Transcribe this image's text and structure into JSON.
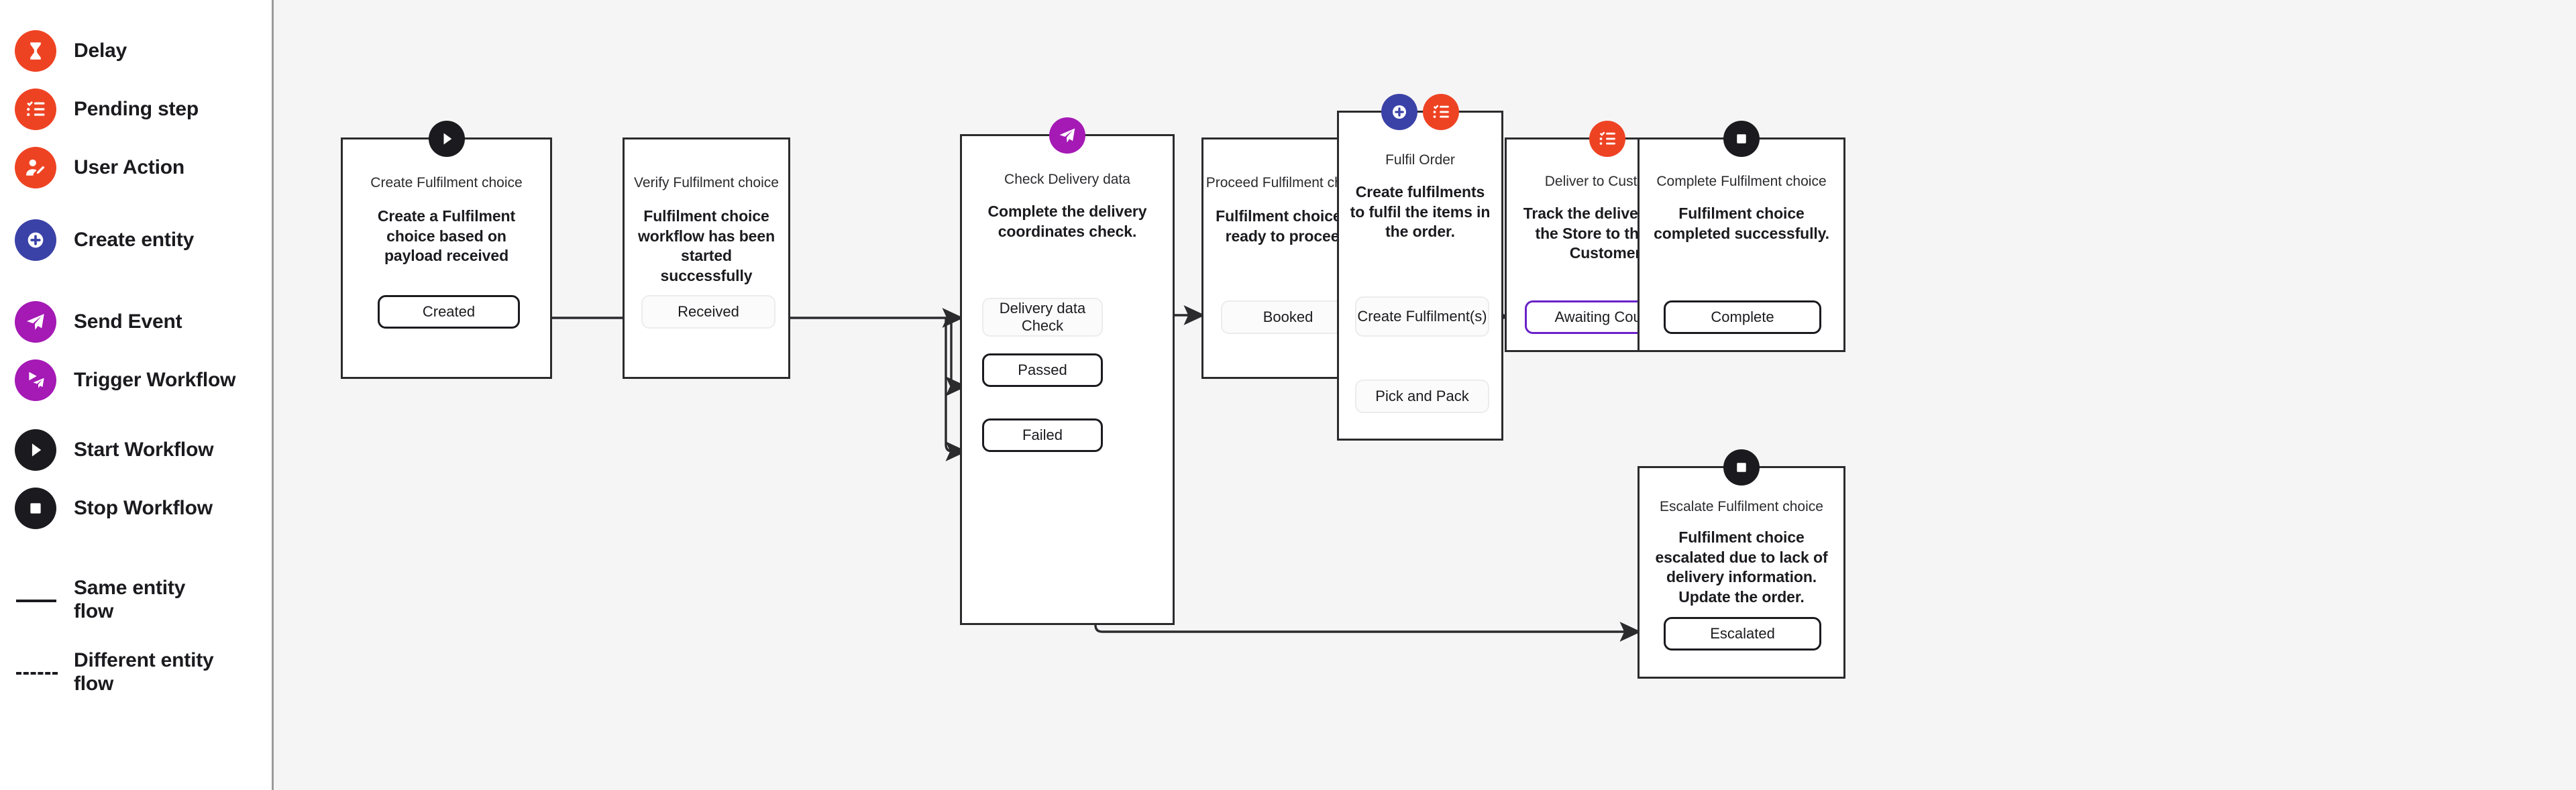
{
  "legend": {
    "items": [
      {
        "label": "Delay",
        "icon": "hourglass-icon",
        "color": "#ee4323",
        "kind": "icon"
      },
      {
        "label": "Pending step",
        "icon": "checklist-icon",
        "color": "#ee4323",
        "kind": "icon"
      },
      {
        "label": "User Action",
        "icon": "user-edit-icon",
        "color": "#ee4323",
        "kind": "icon"
      },
      {
        "label": "Create entity",
        "icon": "plus-circle-icon",
        "color": "#3a42a8",
        "kind": "icon"
      },
      {
        "label": "Send Event",
        "icon": "paper-plane-icon",
        "color": "#a519b5",
        "kind": "icon"
      },
      {
        "label": "Trigger Workflow",
        "icon": "trigger-workflow-icon",
        "color": "#a519b5",
        "kind": "icon"
      },
      {
        "label": "Start Workflow",
        "icon": "play-circle-icon",
        "color": "#1b1b1f",
        "kind": "icon"
      },
      {
        "label": "Stop Workflow",
        "icon": "stop-circle-icon",
        "color": "#1b1b1f",
        "kind": "icon"
      },
      {
        "label": "Same entity\nflow",
        "icon": "solid-line-icon",
        "color": "#1b1b1f",
        "kind": "line-solid"
      },
      {
        "label": "Different entity\nflow",
        "icon": "dashed-line-icon",
        "color": "#1b1b1f",
        "kind": "line-dashed"
      }
    ]
  },
  "diagram": {
    "nodes": [
      {
        "id": "create-fulfilment-choice",
        "title": "Create Fulfilment choice",
        "description": "Create a Fulfilment choice based on payload received",
        "badges": [
          {
            "icon": "play-circle-icon",
            "color": "#1b1b1f"
          }
        ],
        "steps": [
          {
            "label": "Created",
            "style": "strong"
          }
        ]
      },
      {
        "id": "verify-fulfilment-choice",
        "title": "Verify Fulfilment choice",
        "description": "Fulfilment choice workflow has been started successfully",
        "badges": [],
        "steps": [
          {
            "label": "Received",
            "style": "soft"
          }
        ]
      },
      {
        "id": "check-delivery-data",
        "title": "Check Delivery data",
        "description": "Complete the delivery coordinates check.",
        "badges": [
          {
            "icon": "paper-plane-icon",
            "color": "#a519b5"
          }
        ],
        "steps": [
          {
            "label": "Delivery data Check",
            "style": "soft"
          },
          {
            "label": "Passed",
            "style": "strong"
          },
          {
            "label": "Failed",
            "style": "strong"
          }
        ]
      },
      {
        "id": "proceed-fulfilment-choice",
        "title": "Proceed Fulfilment choice",
        "description": "Fulfilment choice is ready to proceed",
        "badges": [],
        "steps": [
          {
            "label": "Booked",
            "style": "soft"
          }
        ]
      },
      {
        "id": "fulfil-order",
        "title": "Fulfil Order",
        "description": "Create fulfilments to fulfil the items in the order.",
        "badges": [
          {
            "icon": "plus-circle-icon",
            "color": "#3a42a8"
          },
          {
            "icon": "checklist-icon",
            "color": "#ee4323"
          }
        ],
        "steps": [
          {
            "label": "Create Fulfilment(s)",
            "style": "soft"
          },
          {
            "label": "Pick and Pack",
            "style": "soft"
          }
        ]
      },
      {
        "id": "deliver-to-customer",
        "title": "Deliver to Customer",
        "description": "Track the delivery from the Store to the end Customer.",
        "badges": [
          {
            "icon": "checklist-icon",
            "color": "#ee4323"
          }
        ],
        "steps": [
          {
            "label": "Awaiting Courier",
            "style": "accent"
          }
        ]
      },
      {
        "id": "complete-fulfilment-choice",
        "title": "Complete Fulfilment choice",
        "description": "Fulfilment choice completed successfully.",
        "badges": [
          {
            "icon": "stop-circle-icon",
            "color": "#1b1b1f"
          }
        ],
        "steps": [
          {
            "label": "Complete",
            "style": "strong"
          }
        ]
      },
      {
        "id": "escalate-fulfilment-choice",
        "title": "Escalate Fulfilment choice",
        "description": "Fulfilment choice escalated due to lack of delivery information. Update the order.",
        "badges": [
          {
            "icon": "stop-circle-icon",
            "color": "#1b1b1f"
          }
        ],
        "steps": [
          {
            "label": "Escalated",
            "style": "strong"
          }
        ]
      }
    ],
    "colors": {
      "canvas_background": "#f5f5f5",
      "node_border": "#2b2b2e",
      "connector": "#2b2b2e",
      "accent_purple": "#6b21c8",
      "orange": "#ee4323",
      "blue": "#3a42a8",
      "magenta": "#a519b5"
    }
  }
}
